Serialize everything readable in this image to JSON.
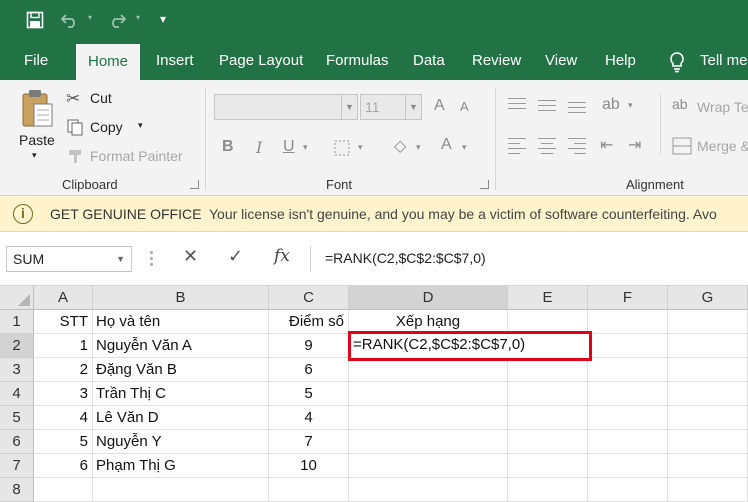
{
  "quick_access": {
    "save_icon": "save-icon",
    "undo_icon": "undo-icon",
    "redo_icon": "redo-icon",
    "customize_icon": "customize-qat-icon"
  },
  "tabs": [
    {
      "label": "File"
    },
    {
      "label": "Home",
      "active": true
    },
    {
      "label": "Insert"
    },
    {
      "label": "Page Layout"
    },
    {
      "label": "Formulas"
    },
    {
      "label": "Data"
    },
    {
      "label": "Review"
    },
    {
      "label": "View"
    },
    {
      "label": "Help"
    }
  ],
  "tell_me": "Tell me",
  "ribbon": {
    "clipboard": {
      "paste": "Paste",
      "cut": "Cut",
      "copy": "Copy",
      "format_painter": "Format Painter",
      "group_label": "Clipboard"
    },
    "font": {
      "font_name": "",
      "font_size": "11",
      "bold": "B",
      "italic": "I",
      "underline": "U",
      "font_color": "A",
      "grow": "A",
      "shrink": "A",
      "group_label": "Font"
    },
    "alignment": {
      "wrap_text": "Wrap Te",
      "merge": "Merge &",
      "group_label": "Alignment"
    }
  },
  "message_bar": {
    "title": "GET GENUINE OFFICE",
    "body": "Your license isn't genuine, and you may be a victim of software counterfeiting. Avo"
  },
  "formula_bar": {
    "name_box": "SUM",
    "cancel": "✕",
    "enter": "✓",
    "fx": "fx",
    "formula": "=RANK(C2,$C$2:$C$7,0)"
  },
  "sheet": {
    "columns": [
      "A",
      "B",
      "C",
      "D",
      "E",
      "F",
      "G"
    ],
    "rows": [
      "1",
      "2",
      "3",
      "4",
      "5",
      "6",
      "7",
      "8"
    ],
    "header": {
      "stt": "STT",
      "name": "Họ và tên",
      "score": "Điểm số",
      "rank": "Xếp hạng"
    },
    "data": [
      {
        "stt": "1",
        "name": "Nguyễn Văn A",
        "score": "9"
      },
      {
        "stt": "2",
        "name": "Đặng Văn B",
        "score": "6"
      },
      {
        "stt": "3",
        "name": "Trần Thị C",
        "score": "5"
      },
      {
        "stt": "4",
        "name": "Lê Văn D",
        "score": "4"
      },
      {
        "stt": "5",
        "name": "Nguyễn Y",
        "score": "7"
      },
      {
        "stt": "6",
        "name": "Phạm Thị G",
        "score": "10"
      }
    ],
    "editing_cell": "D2",
    "editing_value": "=RANK(C2,$C$2:$C$7,0)"
  },
  "colors": {
    "excel_green": "#217346",
    "warning_bg": "#fff4ce",
    "highlight_border": "#e3001b"
  }
}
